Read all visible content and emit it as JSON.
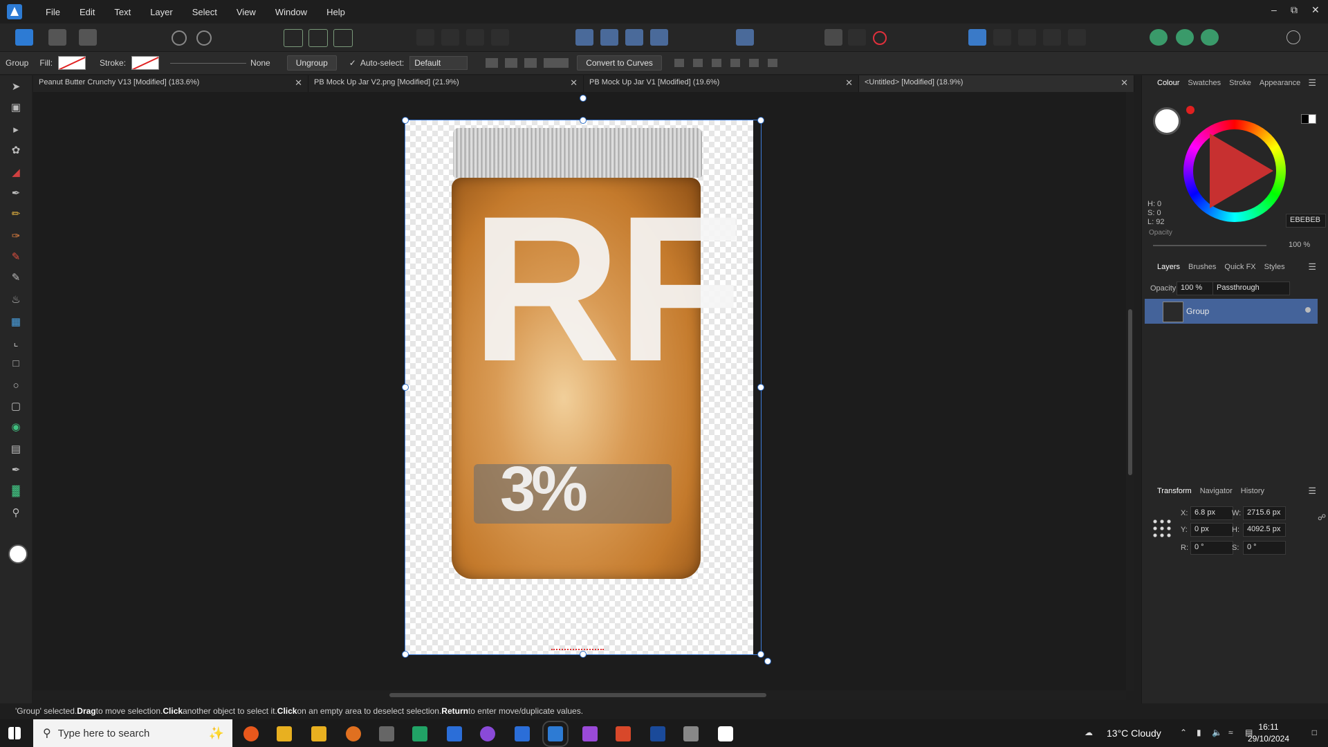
{
  "menu": [
    "File",
    "Edit",
    "Text",
    "Layer",
    "Select",
    "View",
    "Window",
    "Help"
  ],
  "context": {
    "persona": "Group",
    "fill_label": "Fill:",
    "stroke_label": "Stroke:",
    "stroke_style": "None",
    "ungroup": "Ungroup",
    "autoselect": "Auto-select:",
    "autoselect_value": "Default",
    "convert": "Convert to Curves"
  },
  "tabs": [
    "Peanut Butter Crunchy V13 [Modified] (183.6%)",
    "PB Mock Up Jar V2.png [Modified] (21.9%)",
    "PB Mock Up Jar V1 [Modified] (19.6%)",
    "<Untitled> [Modified] (18.9%)"
  ],
  "colour_panel": {
    "tabs": [
      "Colour",
      "Swatches",
      "Stroke",
      "Appearance"
    ],
    "h": "H: 0",
    "s": "S: 0",
    "l": "L: 92",
    "hex": "EBEBEB",
    "opacity_label": "Opacity",
    "opacity_value": "100 %"
  },
  "layers_panel": {
    "tabs": [
      "Layers",
      "Brushes",
      "Quick FX",
      "Styles"
    ],
    "opacity_label": "Opacity:",
    "opacity_value": "100 %",
    "blend_mode": "Passthrough",
    "layer_name": "Group"
  },
  "transform_panel": {
    "tabs": [
      "Transform",
      "Navigator",
      "History"
    ],
    "x_label": "X:",
    "x": "6.8 px",
    "y_label": "Y:",
    "y": "0 px",
    "w_label": "W:",
    "w": "2715.6 px",
    "h_label": "H:",
    "h": "4092.5 px",
    "r_label": "R:",
    "r": "0 °",
    "s_label": "S:",
    "s": "0 °"
  },
  "jar_art": {
    "big": "RF",
    "small": "3%"
  },
  "status": {
    "part1": "'Group' selected. ",
    "drag": "Drag",
    "part2": " to move selection. ",
    "click": "Click",
    "part3": " another object to select it. ",
    "click2": "Click",
    "part4": " on an empty area to deselect selection. ",
    "return": "Return",
    "part5": " to enter move/duplicate values."
  },
  "taskbar": {
    "search_placeholder": "Type here to search",
    "weather": "13°C  Cloudy",
    "time": "16:11",
    "date": "29/10/2024"
  },
  "colors": {
    "accent": "#3c7bd9",
    "layer_selected": "#44639a",
    "primary": "#c73030"
  }
}
